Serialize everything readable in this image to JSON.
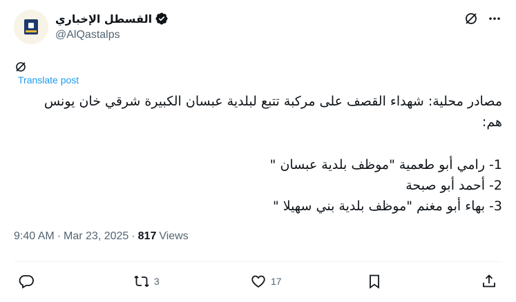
{
  "account": {
    "name": "القسطل الإخباري",
    "handle": "@AlQastalps"
  },
  "translate_label": "Translate post",
  "post": {
    "lines": [
      "مصادر محلية:  شهداء القصف على مركبة تتبع لبلدية عبسان الكبيرة شرقي خان يونس",
      "هم:",
      "1- رامي أبو طعمية \"موظف بلدية عبسان \"",
      "2- أحمد أبو صبحة",
      "3- بهاء أبو مغنم \"موظف بلدية بني سهيلا \""
    ]
  },
  "meta": {
    "time": "9:40 AM",
    "separator": "·",
    "date": "Mar 23, 2025",
    "views_count": "817",
    "views_label": "Views"
  },
  "actions": {
    "reply_count": "",
    "repost_count": "3",
    "like_count": "17"
  },
  "colors": {
    "link": "#1d9bf0",
    "muted": "#536471",
    "text": "#0f1419",
    "divider": "#eff3f4"
  },
  "icons": [
    "verified-badge-icon",
    "grok-icon",
    "more-icon",
    "reply-icon",
    "repost-icon",
    "like-icon",
    "bookmark-icon",
    "share-icon"
  ]
}
